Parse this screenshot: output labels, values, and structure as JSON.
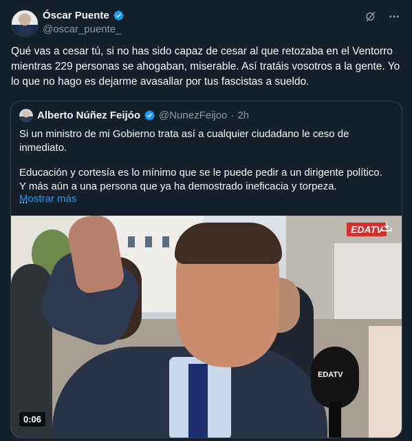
{
  "author": {
    "name": "Óscar Puente",
    "handle": "@oscar_puente_",
    "verified": true
  },
  "top_icons": [
    "grok-icon",
    "more-options-icon"
  ],
  "body_text": "Qué vas a cesar tú, si no has sido capaz de cesar al que retozaba en el Ventorro mientras 229 personas se ahogaban, miserable. Así tratáis vosotros a la gente. Yo lo que no hago es dejarme avasallar por tus fascistas a sueldo.",
  "quote": {
    "name": "Alberto Núñez Feijóo",
    "handle": "@NunezFeijoo",
    "separator": "·",
    "time": "2h",
    "line1": "Si un ministro de mi Gobierno trata así a cualquier ciudadano le ceso de inmediato.",
    "line2": "Educación y cortesía es lo mínimo que se le puede pedir a un dirigente político. Y más aún a una persona que ya ha demostrado ineficacia y torpeza.",
    "ellipsis": "...",
    "show_more": "Mostrar más",
    "media": {
      "logo": "EDATV",
      "mic_label": "EDATV",
      "duration": "0:06"
    }
  },
  "colors": {
    "background": "#15202b",
    "text": "#f7f9f9",
    "muted": "#8b98a5",
    "link": "#1d9bf0",
    "verified": "#1d9bf0",
    "border": "#38444d"
  }
}
